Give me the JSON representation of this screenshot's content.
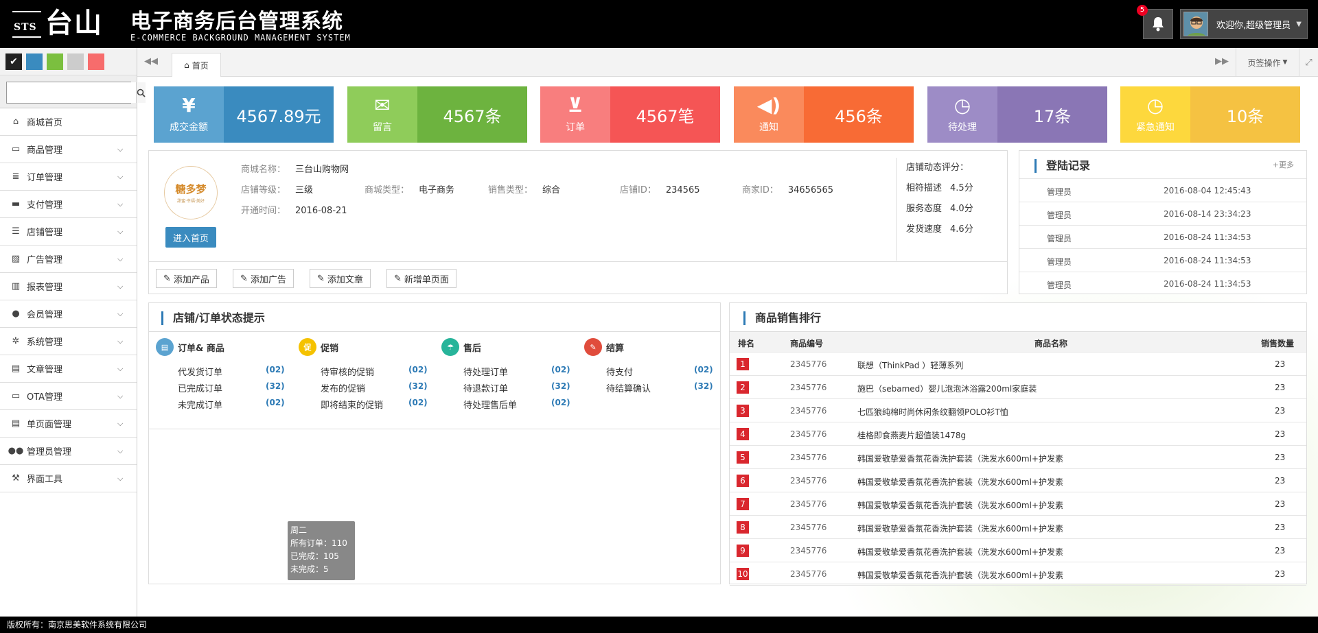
{
  "header": {
    "logo_small": "STS",
    "logo_big": "台山",
    "title": "电子商务后台管理系统",
    "subtitle": "E-COMMERCE BACKGROUND MANAGEMENT SYSTEM",
    "notification_count": "5",
    "welcome": "欢迎你,超级管理员"
  },
  "skins": {
    "colors": [
      "#222222",
      "#3a8bbf",
      "#7bbf3f",
      "#cccccc",
      "#f76c6c"
    ]
  },
  "search": {
    "placeholder": ""
  },
  "sidebar": {
    "items": [
      {
        "label": "商城首页",
        "icon": "home-icon"
      },
      {
        "label": "商品管理",
        "icon": "monitor-icon"
      },
      {
        "label": "订单管理",
        "icon": "database-icon"
      },
      {
        "label": "支付管理",
        "icon": "credit-card-icon"
      },
      {
        "label": "店铺管理",
        "icon": "list-icon"
      },
      {
        "label": "广告管理",
        "icon": "image-icon"
      },
      {
        "label": "报表管理",
        "icon": "bar-chart-icon"
      },
      {
        "label": "会员管理",
        "icon": "user-icon"
      },
      {
        "label": "系统管理",
        "icon": "gears-icon"
      },
      {
        "label": "文章管理",
        "icon": "document-icon"
      },
      {
        "label": "OTA管理",
        "icon": "hdd-icon"
      },
      {
        "label": "单页面管理",
        "icon": "page-icon"
      },
      {
        "label": "管理员管理",
        "icon": "users-icon"
      },
      {
        "label": "界面工具",
        "icon": "wrench-icon"
      }
    ]
  },
  "tabs": {
    "home": "首页",
    "ops": "页签操作"
  },
  "stats": [
    {
      "label": "成交金额",
      "value": "4567.89元",
      "left_color": "#5ba3d0",
      "right_color": "#3a8bbf",
      "icon": "yen-icon"
    },
    {
      "label": "留言",
      "value": "4567条",
      "left_color": "#8fcc5a",
      "right_color": "#6db33f",
      "icon": "comments-icon"
    },
    {
      "label": "订单",
      "value": "4567笔",
      "left_color": "#f87e7e",
      "right_color": "#f55555",
      "icon": "cart-icon"
    },
    {
      "label": "通知",
      "value": "456条",
      "left_color": "#fa8a5c",
      "right_color": "#f86b35",
      "icon": "volume-icon"
    },
    {
      "label": "待处理",
      "value": "17条",
      "left_color": "#9d8cc6",
      "right_color": "#8a76b5",
      "icon": "clock-icon"
    },
    {
      "label": "紧急通知",
      "value": "10条",
      "left_color": "#fdd83d",
      "right_color": "#f5c242",
      "icon": "clock-icon"
    }
  ],
  "shop": {
    "logo_text": "糖多梦",
    "logo_sub": "甜蜜·幸福·美好",
    "enter_button": "进入首页",
    "name_key": "商城名称：",
    "name": "三台山购物网",
    "level_key": "店铺等级：",
    "level": "三级",
    "type_key": "商城类型：",
    "type": "电子商务",
    "sale_key": "销售类型：",
    "sale": "综合",
    "shopid_key": "店铺ID：",
    "shopid": "234565",
    "merchant_key": "商家ID：",
    "merchant": "34656565",
    "open_key": "开通时间：",
    "open": "2016-08-21",
    "score_title": "店铺动态评分：",
    "scores": [
      {
        "k": "相符描述",
        "v": "4.5分"
      },
      {
        "k": "服务态度",
        "v": "4.0分"
      },
      {
        "k": "发货速度",
        "v": "4.6分"
      }
    ],
    "actions": [
      "添加产品",
      "添加广告",
      "添加文章",
      "新增单页面"
    ]
  },
  "login": {
    "title": "登陆记录",
    "more": "+更多",
    "rows": [
      {
        "who": "管理员",
        "when": "2016-08-04 12:45:43"
      },
      {
        "who": "管理员",
        "when": "2016-08-14 23:34:23"
      },
      {
        "who": "管理员",
        "when": "2016-08-24 11:34:53"
      },
      {
        "who": "管理员",
        "when": "2016-08-24 11:34:53"
      },
      {
        "who": "管理员",
        "when": "2016-08-24 11:34:53"
      }
    ]
  },
  "status": {
    "title": "店铺/订单状态提示",
    "columns": [
      {
        "title": "订单& 商品",
        "color": "#5ba3d0",
        "glyph": "▤",
        "rows": [
          {
            "n": "代发货订单",
            "c": "(02)"
          },
          {
            "n": "已完成订单",
            "c": "(32)"
          },
          {
            "n": "未完成订单",
            "c": "(02)"
          }
        ]
      },
      {
        "title": "促销",
        "color": "#f5c200",
        "glyph": "促",
        "rows": [
          {
            "n": "待审核的促销",
            "c": "(02)"
          },
          {
            "n": "发布的促销",
            "c": "(32)"
          },
          {
            "n": "即将结束的促销",
            "c": "(02)"
          }
        ]
      },
      {
        "title": "售后",
        "color": "#27b49a",
        "glyph": "☂",
        "rows": [
          {
            "n": "待处理订单",
            "c": "(02)"
          },
          {
            "n": "待退款订单",
            "c": "(32)"
          },
          {
            "n": "待处理售后单",
            "c": "(02)"
          }
        ]
      },
      {
        "title": "结算",
        "color": "#e04c3c",
        "glyph": "✎",
        "rows": [
          {
            "n": "待支付",
            "c": "(02)"
          },
          {
            "n": "待结算确认",
            "c": "(32)"
          }
        ]
      }
    ],
    "tooltip": {
      "line1": "周二",
      "line2": "所有订单：110",
      "line3": "已完成：105",
      "line4": "未完成：5"
    }
  },
  "ranking": {
    "title": "商品销售排行",
    "headers": {
      "rank": "排名",
      "code": "商品编号",
      "name": "商品名称",
      "qty": "销售数量"
    },
    "rows": [
      {
        "rank": "1",
        "code": "2345776",
        "name": "联想（ThinkPad ）轻薄系列",
        "qty": "23"
      },
      {
        "rank": "2",
        "code": "2345776",
        "name": "施巴（sebamed）婴儿泡泡沐浴露200ml家庭装",
        "qty": "23"
      },
      {
        "rank": "3",
        "code": "2345776",
        "name": "七匹狼纯棉时尚休闲条纹翻领POLO衫T恤",
        "qty": "23"
      },
      {
        "rank": "4",
        "code": "2345776",
        "name": "桂格即食燕麦片超值装1478g",
        "qty": "23"
      },
      {
        "rank": "5",
        "code": "2345776",
        "name": "韩国爱敬挚爱香氛花香洗护套装（洗发水600ml+护发素",
        "qty": "23"
      },
      {
        "rank": "6",
        "code": "2345776",
        "name": "韩国爱敬挚爱香氛花香洗护套装（洗发水600ml+护发素",
        "qty": "23"
      },
      {
        "rank": "7",
        "code": "2345776",
        "name": "韩国爱敬挚爱香氛花香洗护套装（洗发水600ml+护发素",
        "qty": "23"
      },
      {
        "rank": "8",
        "code": "2345776",
        "name": "韩国爱敬挚爱香氛花香洗护套装（洗发水600ml+护发素",
        "qty": "23"
      },
      {
        "rank": "9",
        "code": "2345776",
        "name": "韩国爱敬挚爱香氛花香洗护套装（洗发水600ml+护发素",
        "qty": "23"
      },
      {
        "rank": "10",
        "code": "2345776",
        "name": "韩国爱敬挚爱香氛花香洗护套装（洗发水600ml+护发素",
        "qty": "23"
      }
    ]
  },
  "footer": {
    "text": "版权所有：南京思美软件系统有限公司"
  }
}
